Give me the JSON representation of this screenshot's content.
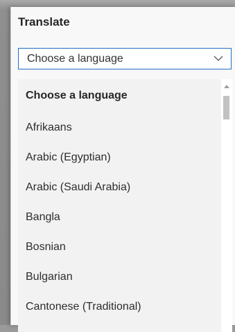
{
  "panel": {
    "title": "Translate"
  },
  "select": {
    "value": "Choose a language",
    "icon": "chevron-down-icon"
  },
  "dropdown": {
    "options": [
      "Choose a language",
      "Afrikaans",
      "Arabic (Egyptian)",
      "Arabic (Saudi Arabia)",
      "Bangla",
      "Bosnian",
      "Bulgarian",
      "Cantonese (Traditional)"
    ]
  },
  "colors": {
    "accent": "#1f6fc4",
    "panel_bg": "#f8f8f8",
    "list_bg": "#f2f2f2"
  }
}
